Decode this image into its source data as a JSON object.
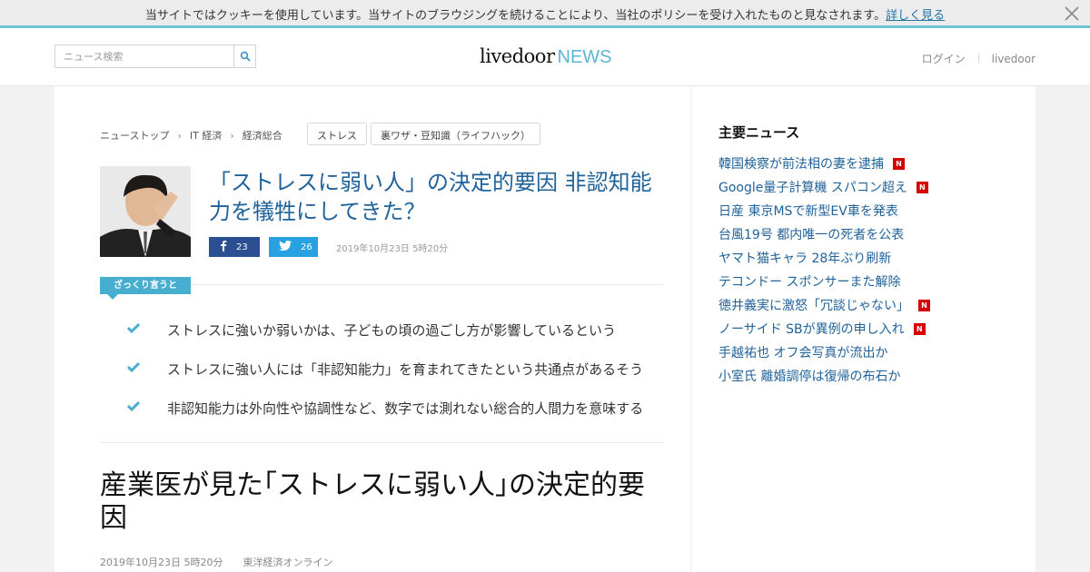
{
  "cookie_bar": {
    "text": "当サイトではクッキーを使用しています。当サイトのブラウジングを続けることにより、当社のポリシーを受け入れたものと見なされます。",
    "link": "詳しく見る"
  },
  "header": {
    "search_placeholder": "ニュース検索",
    "logo_main": "livedoor",
    "logo_sub": "NEWS",
    "links": [
      "ログイン",
      "livedoor"
    ]
  },
  "breadcrumb": [
    "ニューストップ",
    "IT 経済",
    "経済総合"
  ],
  "tags": [
    "ストレス",
    "裏ワザ・豆知識（ライフハック）"
  ],
  "article": {
    "title": "「ストレスに弱い人」の決定的要因 非認知能力を犠牲にしてきた？",
    "facebook_count": "23",
    "twitter_count": "26",
    "date": "2019年10月23日 5時20分",
    "summary_label": "ざっくり言うと",
    "points": [
      "ストレスに強いか弱いかは、子どもの頃の過ごし方が影響しているという",
      "ストレスに強い人には「非認知能力」を育まれてきたという共通点があるそう",
      "非認知能力は外向性や協調性など、数字では測れない総合的人間力を意味する"
    ],
    "headline": "産業医が見た｢ストレスに弱い人｣の決定的要因",
    "meta_date": "2019年10月23日 5時20分",
    "source": "東洋経済オンライン"
  },
  "sidebar": {
    "title": "主要ニュース",
    "new_badge": "N",
    "items": [
      {
        "text": "韓国検察が前法相の妻を逮捕",
        "new": true
      },
      {
        "text": "Google量子計算機 スパコン超え",
        "new": true
      },
      {
        "text": "日産 東京MSで新型EV車を発表",
        "new": false
      },
      {
        "text": "台風19号 都内唯一の死者を公表",
        "new": false
      },
      {
        "text": "ヤマト猫キャラ 28年ぶり刷新",
        "new": false
      },
      {
        "text": "テコンドー スポンサーまた解除",
        "new": false
      },
      {
        "text": "徳井義実に激怒「冗談じゃない」",
        "new": true
      },
      {
        "text": "ノーサイド SBが異例の申し入れ",
        "new": true
      },
      {
        "text": "手越祐也 オフ会写真が流出か",
        "new": false
      },
      {
        "text": "小室氏 離婚調停は復帰の布石か",
        "new": false
      }
    ]
  },
  "colors": {
    "accent": "#47aed0",
    "link": "#20629a",
    "facebook": "#2c4f91",
    "twitter": "#27a1e2",
    "new_badge": "#d50000"
  }
}
